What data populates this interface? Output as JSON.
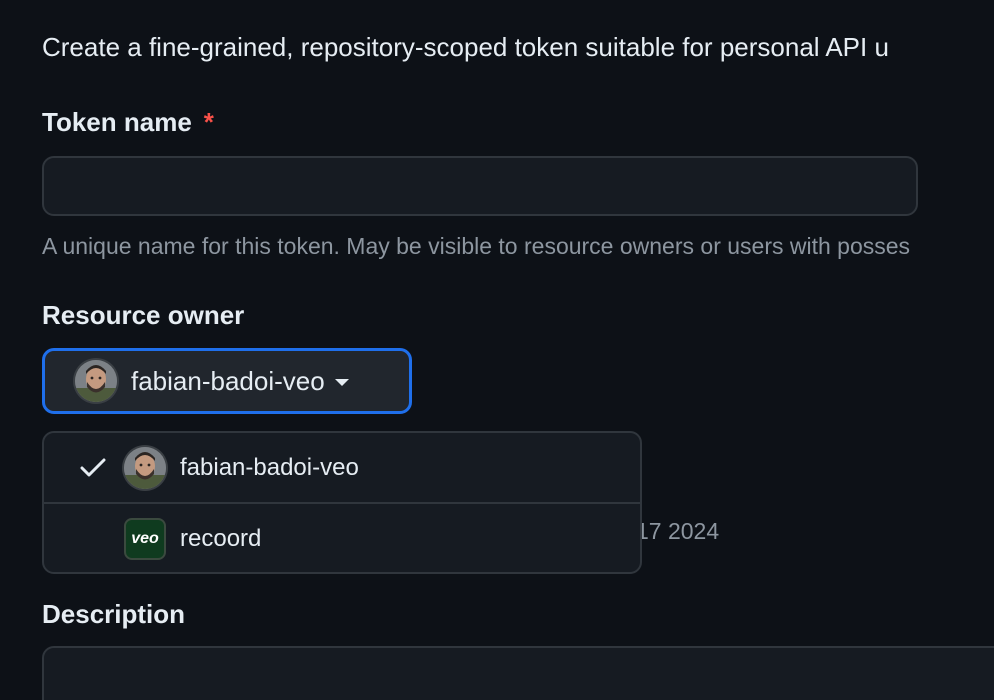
{
  "intro": {
    "text": "Create a fine-grained, repository-scoped token suitable for personal API u"
  },
  "token_name": {
    "label": "Token name",
    "required_marker": "*",
    "value": "",
    "placeholder": "",
    "hint": "A unique name for this token. May be visible to resource owners or users with posses"
  },
  "resource_owner": {
    "label": "Resource owner",
    "selected": "fabian-badoi-veo",
    "options": [
      {
        "label": "fabian-badoi-veo",
        "checked": true,
        "icon": "user-avatar"
      },
      {
        "label": "recoord",
        "checked": false,
        "icon": "org-logo",
        "logo_text": "veo"
      }
    ]
  },
  "obscured": {
    "expiration_fragment": "17 2024"
  },
  "description": {
    "label": "Description",
    "value": ""
  },
  "colors": {
    "background": "#0d1117",
    "input_bg": "#161b22",
    "border": "#30363d",
    "accent_focus": "#1f6feb",
    "required": "#f85149",
    "muted_text": "#8d96a0",
    "org_logo_bg": "#0f3b1f"
  }
}
